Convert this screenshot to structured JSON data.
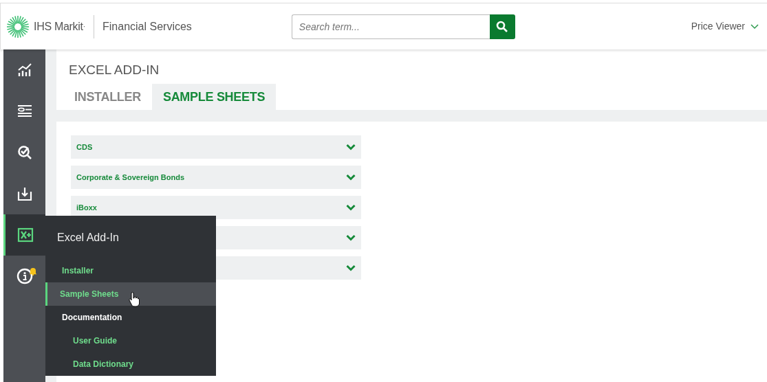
{
  "header": {
    "brand": "IHS Markit",
    "brand_mark": "·",
    "product": "Financial Services",
    "search": {
      "placeholder": "Search term..."
    },
    "user_menu": "Price Viewer"
  },
  "sidebar": {
    "items": [
      {
        "kind": "chart",
        "selected": false
      },
      {
        "kind": "list",
        "selected": false
      },
      {
        "kind": "search",
        "selected": false
      },
      {
        "kind": "download",
        "selected": false
      },
      {
        "kind": "excel",
        "selected": true
      },
      {
        "kind": "info",
        "selected": false,
        "notification": true
      }
    ]
  },
  "flyout": {
    "title": "Excel Add-In",
    "items": [
      {
        "label": "Installer",
        "kind": "link",
        "selected": false
      },
      {
        "label": "Sample Sheets",
        "kind": "link",
        "selected": true
      },
      {
        "label": "Documentation",
        "kind": "heading",
        "selected": false,
        "children": [
          {
            "label": "User Guide",
            "kind": "link",
            "selected": false
          },
          {
            "label": "Data Dictionary",
            "kind": "link",
            "selected": false
          }
        ]
      }
    ]
  },
  "page": {
    "title": "EXCEL ADD-IN",
    "tabs": [
      {
        "label": "INSTALLER",
        "selected": false
      },
      {
        "label": "SAMPLE SHEETS",
        "selected": true
      }
    ],
    "accordion": [
      {
        "title": "CDS",
        "expanded": false
      },
      {
        "title": "Corporate & Sovereign Bonds",
        "expanded": false
      },
      {
        "title": "iBoxx",
        "expanded": false
      },
      {
        "expanded": false
      },
      {
        "expanded": false
      }
    ]
  }
}
